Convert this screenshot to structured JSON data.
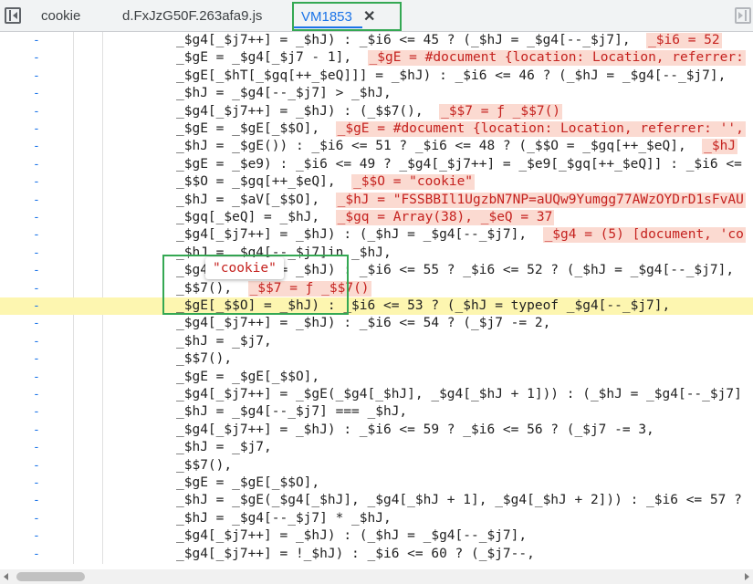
{
  "tabs": [
    {
      "label": "cookie"
    },
    {
      "label": "d.FxJzG50F.263afa9.js"
    },
    {
      "label": "VM1853"
    }
  ],
  "active_tab_close": "✕",
  "line_marker": "-",
  "popover_value": "\"cookie\"",
  "lines": [
    {
      "code": "_$g4[_$j7++] = _$hJ) : _$i6 <= 45 ? (_$hJ = _$g4[--_$j7],",
      "val": "_$i6 = 52"
    },
    {
      "code": "_$gE = _$g4[_$j7 - 1],",
      "val": "_$gE = #document {location: Location, referrer:"
    },
    {
      "code": "_$gE[_$hT[_$gq[++_$eQ]]] = _$hJ) : _$i6 <= 46 ? (_$hJ = _$g4[--_$j7],",
      "val": ""
    },
    {
      "code": "_$hJ = _$g4[--_$j7] > _$hJ,",
      "val": ""
    },
    {
      "code": "_$g4[_$j7++] = _$hJ) : (_$$7(),",
      "val": "_$$7 = ƒ _$$7()"
    },
    {
      "code": "_$gE = _$gE[_$$O],",
      "val": "_$gE = #document {location: Location, referrer: '',"
    },
    {
      "code": "_$hJ = _$gE()) : _$i6 <= 51 ? _$i6 <= 48 ? (_$$O = _$gq[++_$eQ],",
      "val": "_$hJ"
    },
    {
      "code": "_$gE = _$e9) : _$i6 <= 49 ? _$g4[_$j7++] = _$e9[_$gq[++_$eQ]] : _$i6 <=",
      "val": ""
    },
    {
      "code": "_$$O = _$gq[++_$eQ],",
      "val": "_$$O = \"cookie\""
    },
    {
      "code": "_$hJ = _$aV[_$$O],",
      "val": "_$hJ = \"FSSBBIl1UgzbN7NP=aUQw9Yumgg77AWzOYDrD1sFvAU"
    },
    {
      "code": "_$gq[_$eQ] = _$hJ,",
      "val": "_$gq = Array(38), _$eQ = 37"
    },
    {
      "code": "_$g4[_$j7++] = _$hJ) : (_$hJ = _$g4[--_$j7],",
      "val": "_$g4 = (5) [document, 'co"
    },
    {
      "code": "_$hJ = _$g4[--_$j7]in _$hJ,",
      "val": ""
    },
    {
      "code": "_$g4[_$j7++] = _$hJ) : _$i6 <= 55 ? _$i6 <= 52 ? (_$hJ = _$g4[--_$j7],",
      "val": ""
    },
    {
      "code": "_$$7(),",
      "val": "_$$7 = ƒ _$$7()"
    },
    {
      "code": "_$gE[_$$O] = _$hJ) : _$i6 <= 53 ? (_$hJ = typeof _$g4[--_$j7],",
      "val": ""
    },
    {
      "code": "_$g4[_$j7++] = _$hJ) : _$i6 <= 54 ? (_$j7 -= 2,",
      "val": ""
    },
    {
      "code": "_$hJ = _$j7,",
      "val": ""
    },
    {
      "code": "_$$7(),",
      "val": ""
    },
    {
      "code": "_$gE = _$gE[_$$O],",
      "val": ""
    },
    {
      "code": "_$g4[_$j7++] = _$gE(_$g4[_$hJ], _$g4[_$hJ + 1])) : (_$hJ = _$g4[--_$j7]",
      "val": ""
    },
    {
      "code": "_$hJ = _$g4[--_$j7] === _$hJ,",
      "val": ""
    },
    {
      "code": "_$g4[_$j7++] = _$hJ) : _$i6 <= 59 ? _$i6 <= 56 ? (_$j7 -= 3,",
      "val": ""
    },
    {
      "code": "_$hJ = _$j7,",
      "val": ""
    },
    {
      "code": "_$$7(),",
      "val": ""
    },
    {
      "code": "_$gE = _$gE[_$$O],",
      "val": ""
    },
    {
      "code": "_$hJ = _$gE(_$g4[_$hJ], _$g4[_$hJ + 1], _$g4[_$hJ + 2])) : _$i6 <= 57 ?",
      "val": ""
    },
    {
      "code": "_$hJ = _$g4[--_$j7] * _$hJ,",
      "val": ""
    },
    {
      "code": "_$g4[_$j7++] = _$hJ) : (_$hJ = _$g4[--_$j7],",
      "val": ""
    },
    {
      "code": "_$g4[_$j7++] = !_$hJ) : _$i6 <= 60 ? (_$j7--,",
      "val": ""
    },
    {
      "code": "_$hJ = _$j7,",
      "val": ""
    }
  ],
  "highlight_line": 15
}
